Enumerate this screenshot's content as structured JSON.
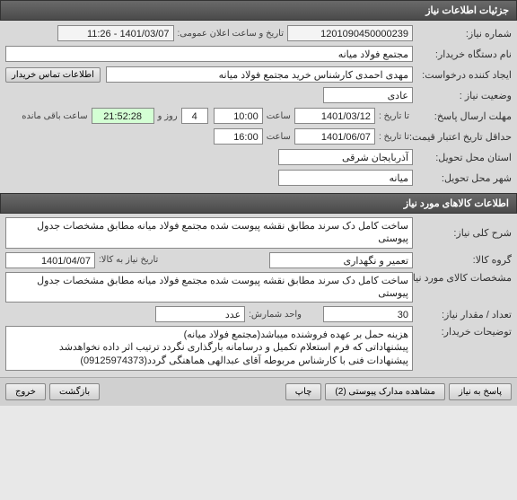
{
  "headers": {
    "need_info": "جزئیات اطلاعات نیاز",
    "goods_info": "اطلاعات کالاهای مورد نیاز"
  },
  "labels": {
    "need_no": "شماره نیاز:",
    "announce_dt": "تاریخ و ساعت اعلان عمومی:",
    "buyer_name": "نام دستگاه خریدار:",
    "creator": "ایجاد کننده درخواست:",
    "contact_btn": "اطلاعات تماس خریدار",
    "need_status": "وضعیت نیاز :",
    "reply_deadline": "مهلت ارسال پاسخ:",
    "to_date": "تا تاریخ :",
    "time": "ساعت",
    "day_and": "روز و",
    "remain": "ساعت باقی مانده",
    "price_valid": "حداقل تاریخ اعتبار قیمت:",
    "province": "استان محل تحویل:",
    "city": "شهر محل تحویل:",
    "goods_desc": "شرح کلی نیاز:",
    "goods_group": "گروه کالا:",
    "need_date": "تاریخ نیاز به کالا:",
    "goods_spec": "مشخصات کالای مورد نیاز:",
    "qty": "تعداد / مقدار نیاز:",
    "unit": "واحد شمارش:",
    "buyer_notes": "توضیحات خریدار:"
  },
  "values": {
    "need_no": "1201090450000239",
    "announce_dt": "1401/03/07 - 11:26",
    "buyer_name": "مجتمع فولاد میانه",
    "creator": "مهدی احمدی کارشناس خرید مجتمع فولاد میانه",
    "need_status": "عادی",
    "deadline_date": "1401/03/12",
    "deadline_time": "10:00",
    "remain_days": "4",
    "remain_time": "21:52:28",
    "valid_date": "1401/06/07",
    "valid_time": "16:00",
    "province": "آذربایجان شرقی",
    "city": "میانه",
    "goods_desc": "ساخت کامل دک سرند مطابق نقشه پیوست شده مجتمع فولاد میانه مطابق مشخصات جدول پیوستی",
    "goods_group": "تعمیر و نگهداری",
    "need_date": "1401/04/07",
    "goods_spec": "ساخت کامل دک سرند مطابق نقشه پیوست شده مجتمع فولاد میانه مطابق مشخصات جدول پیوستی",
    "qty": "30",
    "unit": "عدد",
    "buyer_notes": "هزینه حمل بر عهده فروشنده میباشد(مجتمع فولاد میانه)\nپیشنهاداتی که فرم استعلام تکمیل و درسامانه بارگذاری نگردد ترتیب اثر داده نخواهدشد\nپیشنهادات فنی با کارشناس مربوطه آقای عبدالهی هماهنگی گردد(09125974373)"
  },
  "footer": {
    "reply": "پاسخ به نیاز",
    "attachments": "مشاهده مدارک پیوستی (2)",
    "print": "چاپ",
    "back": "بازگشت",
    "exit": "خروج"
  }
}
